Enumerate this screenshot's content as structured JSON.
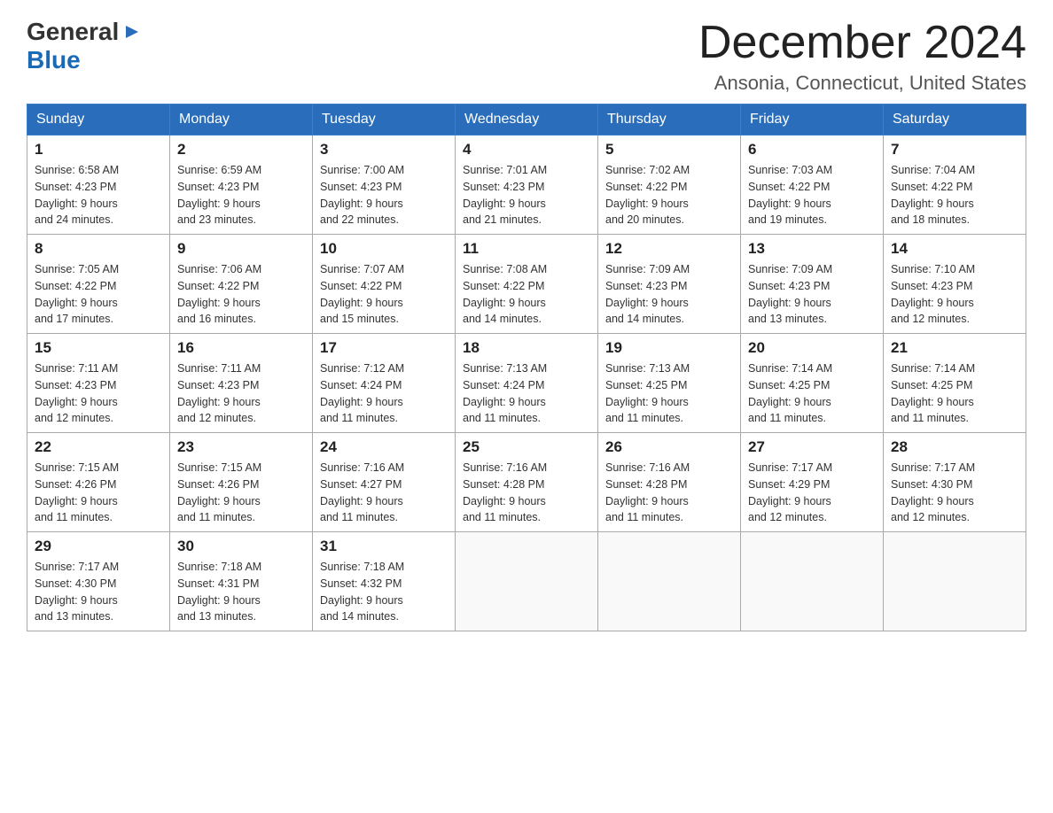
{
  "header": {
    "logo_general": "General",
    "logo_blue": "Blue",
    "month_title": "December 2024",
    "location": "Ansonia, Connecticut, United States"
  },
  "weekdays": [
    "Sunday",
    "Monday",
    "Tuesday",
    "Wednesday",
    "Thursday",
    "Friday",
    "Saturday"
  ],
  "weeks": [
    [
      {
        "day": "1",
        "sunrise": "6:58 AM",
        "sunset": "4:23 PM",
        "daylight": "9 hours and 24 minutes."
      },
      {
        "day": "2",
        "sunrise": "6:59 AM",
        "sunset": "4:23 PM",
        "daylight": "9 hours and 23 minutes."
      },
      {
        "day": "3",
        "sunrise": "7:00 AM",
        "sunset": "4:23 PM",
        "daylight": "9 hours and 22 minutes."
      },
      {
        "day": "4",
        "sunrise": "7:01 AM",
        "sunset": "4:23 PM",
        "daylight": "9 hours and 21 minutes."
      },
      {
        "day": "5",
        "sunrise": "7:02 AM",
        "sunset": "4:22 PM",
        "daylight": "9 hours and 20 minutes."
      },
      {
        "day": "6",
        "sunrise": "7:03 AM",
        "sunset": "4:22 PM",
        "daylight": "9 hours and 19 minutes."
      },
      {
        "day": "7",
        "sunrise": "7:04 AM",
        "sunset": "4:22 PM",
        "daylight": "9 hours and 18 minutes."
      }
    ],
    [
      {
        "day": "8",
        "sunrise": "7:05 AM",
        "sunset": "4:22 PM",
        "daylight": "9 hours and 17 minutes."
      },
      {
        "day": "9",
        "sunrise": "7:06 AM",
        "sunset": "4:22 PM",
        "daylight": "9 hours and 16 minutes."
      },
      {
        "day": "10",
        "sunrise": "7:07 AM",
        "sunset": "4:22 PM",
        "daylight": "9 hours and 15 minutes."
      },
      {
        "day": "11",
        "sunrise": "7:08 AM",
        "sunset": "4:22 PM",
        "daylight": "9 hours and 14 minutes."
      },
      {
        "day": "12",
        "sunrise": "7:09 AM",
        "sunset": "4:23 PM",
        "daylight": "9 hours and 14 minutes."
      },
      {
        "day": "13",
        "sunrise": "7:09 AM",
        "sunset": "4:23 PM",
        "daylight": "9 hours and 13 minutes."
      },
      {
        "day": "14",
        "sunrise": "7:10 AM",
        "sunset": "4:23 PM",
        "daylight": "9 hours and 12 minutes."
      }
    ],
    [
      {
        "day": "15",
        "sunrise": "7:11 AM",
        "sunset": "4:23 PM",
        "daylight": "9 hours and 12 minutes."
      },
      {
        "day": "16",
        "sunrise": "7:11 AM",
        "sunset": "4:23 PM",
        "daylight": "9 hours and 12 minutes."
      },
      {
        "day": "17",
        "sunrise": "7:12 AM",
        "sunset": "4:24 PM",
        "daylight": "9 hours and 11 minutes."
      },
      {
        "day": "18",
        "sunrise": "7:13 AM",
        "sunset": "4:24 PM",
        "daylight": "9 hours and 11 minutes."
      },
      {
        "day": "19",
        "sunrise": "7:13 AM",
        "sunset": "4:25 PM",
        "daylight": "9 hours and 11 minutes."
      },
      {
        "day": "20",
        "sunrise": "7:14 AM",
        "sunset": "4:25 PM",
        "daylight": "9 hours and 11 minutes."
      },
      {
        "day": "21",
        "sunrise": "7:14 AM",
        "sunset": "4:25 PM",
        "daylight": "9 hours and 11 minutes."
      }
    ],
    [
      {
        "day": "22",
        "sunrise": "7:15 AM",
        "sunset": "4:26 PM",
        "daylight": "9 hours and 11 minutes."
      },
      {
        "day": "23",
        "sunrise": "7:15 AM",
        "sunset": "4:26 PM",
        "daylight": "9 hours and 11 minutes."
      },
      {
        "day": "24",
        "sunrise": "7:16 AM",
        "sunset": "4:27 PM",
        "daylight": "9 hours and 11 minutes."
      },
      {
        "day": "25",
        "sunrise": "7:16 AM",
        "sunset": "4:28 PM",
        "daylight": "9 hours and 11 minutes."
      },
      {
        "day": "26",
        "sunrise": "7:16 AM",
        "sunset": "4:28 PM",
        "daylight": "9 hours and 11 minutes."
      },
      {
        "day": "27",
        "sunrise": "7:17 AM",
        "sunset": "4:29 PM",
        "daylight": "9 hours and 12 minutes."
      },
      {
        "day": "28",
        "sunrise": "7:17 AM",
        "sunset": "4:30 PM",
        "daylight": "9 hours and 12 minutes."
      }
    ],
    [
      {
        "day": "29",
        "sunrise": "7:17 AM",
        "sunset": "4:30 PM",
        "daylight": "9 hours and 13 minutes."
      },
      {
        "day": "30",
        "sunrise": "7:18 AM",
        "sunset": "4:31 PM",
        "daylight": "9 hours and 13 minutes."
      },
      {
        "day": "31",
        "sunrise": "7:18 AM",
        "sunset": "4:32 PM",
        "daylight": "9 hours and 14 minutes."
      },
      null,
      null,
      null,
      null
    ]
  ],
  "labels": {
    "sunrise": "Sunrise:",
    "sunset": "Sunset:",
    "daylight": "Daylight:"
  }
}
